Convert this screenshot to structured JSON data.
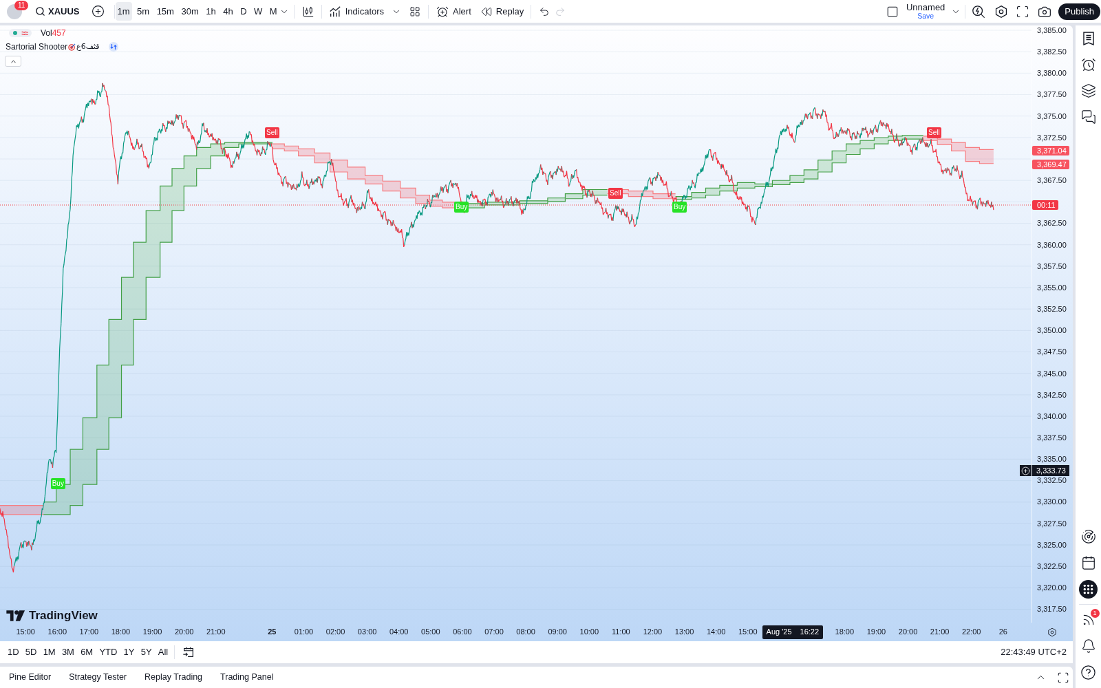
{
  "header": {
    "notification_count": "11",
    "symbol": "XAUUS",
    "intervals": [
      {
        "label": "1m",
        "selected": true
      },
      {
        "label": "5m",
        "selected": false
      },
      {
        "label": "15m",
        "selected": false
      },
      {
        "label": "30m",
        "selected": false
      },
      {
        "label": "1h",
        "selected": false
      },
      {
        "label": "4h",
        "selected": false
      },
      {
        "label": "D",
        "selected": false
      },
      {
        "label": "W",
        "selected": false
      },
      {
        "label": "M",
        "selected": false
      }
    ],
    "indicators": "Indicators",
    "alert": "Alert",
    "replay": "Replay",
    "undo": {
      "disabled": false
    },
    "redo": {
      "disabled": true
    },
    "layout": {
      "name": "Unnamed",
      "action": "Save"
    },
    "publish": "Publish"
  },
  "legend": {
    "volume": {
      "label": "Vol",
      "value": "457"
    },
    "indicator": {
      "name": "Sartorial Shooter",
      "suffix": "قثف6ع"
    }
  },
  "chart": {
    "signals": [
      {
        "kind": "buy",
        "label": "Buy"
      },
      {
        "kind": "sell",
        "label": "Sell"
      },
      {
        "kind": "buy",
        "label": "Buy"
      },
      {
        "kind": "sell",
        "label": "Sell"
      },
      {
        "kind": "buy",
        "label": "Buy"
      },
      {
        "kind": "sell",
        "label": "Sell"
      }
    ],
    "logo": "TradingView",
    "crosshair_price": "3,333.73",
    "price_axis": {
      "rows": [
        {
          "kind": "tick",
          "label": "3,385.00"
        },
        {
          "kind": "tick",
          "label": "3,382.50"
        },
        {
          "kind": "tick",
          "label": "3,380.00"
        },
        {
          "kind": "tick",
          "label": "3,377.50"
        },
        {
          "kind": "tick",
          "label": "3,375.00"
        },
        {
          "kind": "tick",
          "label": "3,372.50"
        },
        {
          "kind": "tags",
          "tags": [
            {
              "label": "3,371.04",
              "color": "#f7525f"
            },
            {
              "label": "3,369.47",
              "color": "#f7525f"
            }
          ]
        },
        {
          "kind": "tick",
          "label": "3,367.50"
        },
        {
          "kind": "tags",
          "tags": [
            {
              "label": "00:11",
              "color": "#f23645"
            }
          ]
        },
        {
          "kind": "tick",
          "label": "3,362.50"
        },
        {
          "kind": "tick",
          "label": "3,360.00"
        },
        {
          "kind": "tick",
          "label": "3,357.50"
        },
        {
          "kind": "tick",
          "label": "3,355.00"
        },
        {
          "kind": "tick",
          "label": "3,352.50"
        },
        {
          "kind": "tick",
          "label": "3,350.00"
        },
        {
          "kind": "tick",
          "label": "3,347.50"
        },
        {
          "kind": "tick",
          "label": "3,345.00"
        },
        {
          "kind": "tick",
          "label": "3,342.50"
        },
        {
          "kind": "tick",
          "label": "3,340.00"
        },
        {
          "kind": "tick",
          "label": "3,337.50"
        },
        {
          "kind": "tick",
          "label": "3,335.00"
        },
        {
          "kind": "tick",
          "label": "3,332.50"
        },
        {
          "kind": "tick",
          "label": "3,330.00"
        },
        {
          "kind": "tick",
          "label": "3,327.50"
        },
        {
          "kind": "tick",
          "label": "3,325.00"
        },
        {
          "kind": "tick",
          "label": "3,322.50"
        },
        {
          "kind": "tick",
          "label": "3,320.00"
        },
        {
          "kind": "tick",
          "label": "3,317.50"
        }
      ]
    },
    "time_axis": {
      "labels": [
        {
          "kind": "time",
          "label": "15:00"
        },
        {
          "kind": "time",
          "label": "16:00"
        },
        {
          "kind": "time",
          "label": "17:00"
        },
        {
          "kind": "time",
          "label": "18:00"
        },
        {
          "kind": "time",
          "label": "19:00"
        },
        {
          "kind": "time",
          "label": "20:00"
        },
        {
          "kind": "time",
          "label": "21:00"
        },
        {
          "kind": "session_start",
          "label": "25"
        },
        {
          "kind": "time",
          "label": "01:00"
        },
        {
          "kind": "time",
          "label": "02:00"
        },
        {
          "kind": "time",
          "label": "03:00"
        },
        {
          "kind": "time",
          "label": "04:00"
        },
        {
          "kind": "time",
          "label": "05:00"
        },
        {
          "kind": "time",
          "label": "06:00"
        },
        {
          "kind": "time",
          "label": "07:00"
        },
        {
          "kind": "time",
          "label": "08:00"
        },
        {
          "kind": "time",
          "label": "09:00"
        },
        {
          "kind": "time",
          "label": "10:00"
        },
        {
          "kind": "time",
          "label": "11:00"
        },
        {
          "kind": "time",
          "label": "12:00"
        },
        {
          "kind": "time",
          "label": "13:00"
        },
        {
          "kind": "time",
          "label": "14:00"
        },
        {
          "kind": "time",
          "label": "15:00"
        },
        {
          "kind": "crosshair",
          "date": "Aug '25",
          "time": "16:22"
        },
        {
          "kind": "time",
          "label": "18:00"
        },
        {
          "kind": "time",
          "label": "19:00"
        },
        {
          "kind": "time",
          "label": "20:00"
        },
        {
          "kind": "time",
          "label": "21:00"
        },
        {
          "kind": "time",
          "label": "22:00"
        },
        {
          "kind": "date",
          "label": "26"
        }
      ]
    }
  },
  "range_bar": {
    "ranges": [
      "1D",
      "5D",
      "1M",
      "3M",
      "6M",
      "YTD",
      "1Y",
      "5Y",
      "All"
    ],
    "clock": "22:43:49 UTC+2"
  },
  "bottom_panel": {
    "tabs": [
      {
        "label": "Pine Editor",
        "selected": false
      },
      {
        "label": "Strategy Tester",
        "selected": false
      },
      {
        "label": "Replay Trading",
        "selected": false
      },
      {
        "label": "Trading Panel",
        "selected": false
      }
    ]
  },
  "sidebar": {
    "alerts_badge": "1"
  }
}
